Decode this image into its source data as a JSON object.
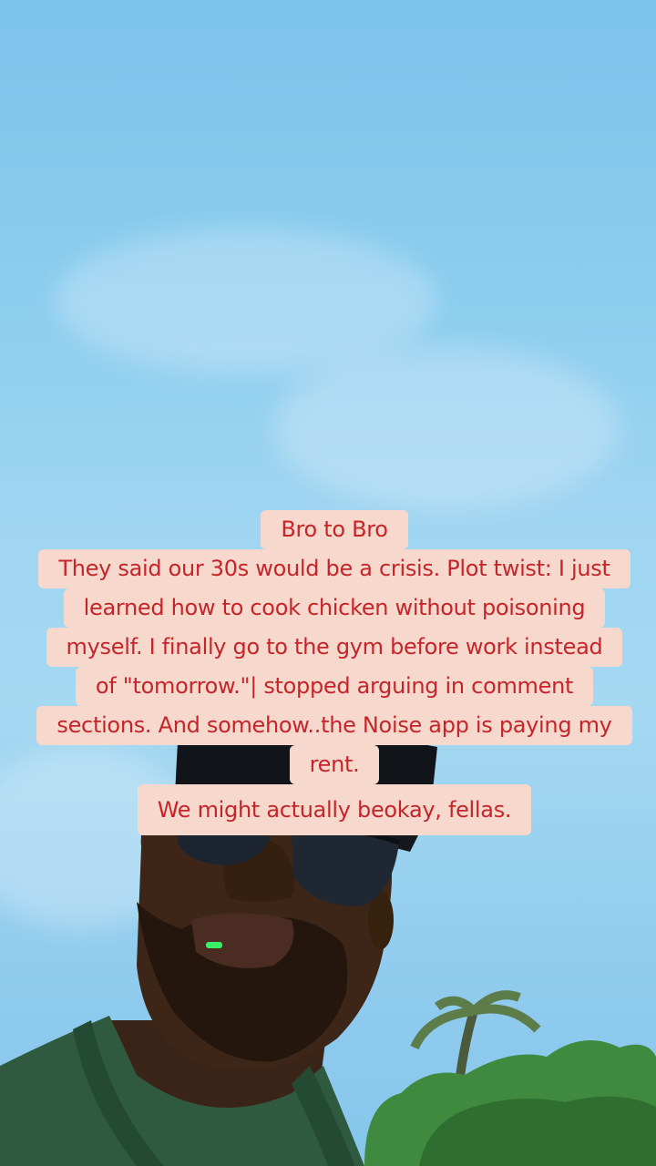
{
  "caption": {
    "lines": [
      "Bro to Bro",
      "They said our 30s would be a crisis. Plot twist: I just",
      "learned how to cook chicken without poisoning",
      "myself. I finally go to the gym before work instead",
      "of \"tomorrow.\"| stopped arguing in comment",
      "sections. And somehow..the Noise app is paying my",
      "rent.",
      "We might actually beokay, fellas."
    ]
  },
  "colors": {
    "caption_text": "#c5252a",
    "caption_background": "#f6d9cc",
    "sky": "#a5d9f2"
  }
}
